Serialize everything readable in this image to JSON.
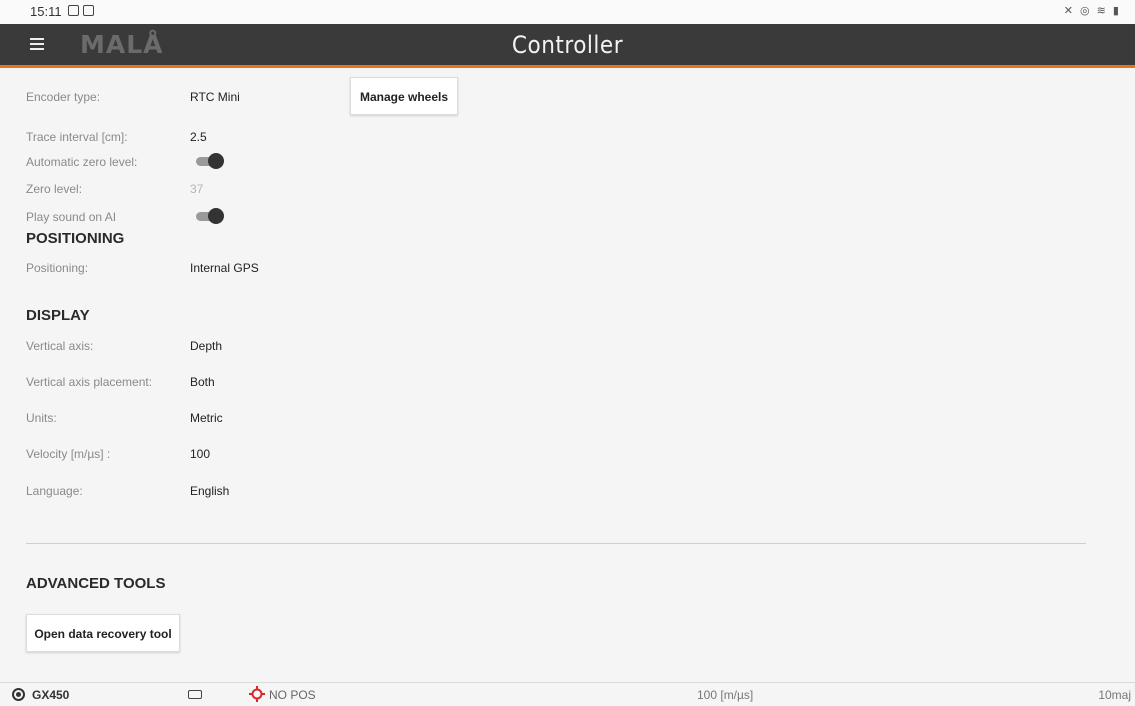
{
  "status_bar": {
    "time": "15:11"
  },
  "app_bar": {
    "logo": "MALÅ",
    "title": "Controller"
  },
  "settings": {
    "encoder_type": {
      "label": "Encoder type:",
      "value": "RTC Mini"
    },
    "manage_wheels_button": "Manage wheels",
    "trace_interval": {
      "label": "Trace interval [cm]:",
      "value": "2.5"
    },
    "automatic_zero_level": {
      "label": "Automatic zero level:",
      "enabled": true
    },
    "zero_level": {
      "label": "Zero level:",
      "value": "37"
    },
    "play_sound": {
      "label": "Play sound on AI",
      "enabled": true
    }
  },
  "positioning": {
    "heading": "POSITIONING",
    "positioning": {
      "label": "Positioning:",
      "value": "Internal GPS"
    }
  },
  "display": {
    "heading": "DISPLAY",
    "vertical_axis": {
      "label": "Vertical axis:",
      "value": "Depth"
    },
    "vertical_axis_placement": {
      "label": "Vertical axis placement:",
      "value": "Both"
    },
    "units": {
      "label": "Units:",
      "value": "Metric"
    },
    "velocity": {
      "label": "Velocity [m/µs] :",
      "value": "100"
    },
    "language": {
      "label": "Language:",
      "value": "English"
    }
  },
  "advanced_tools": {
    "heading": "ADVANCED TOOLS",
    "recovery_button": "Open data recovery tool"
  },
  "bottom_bar": {
    "device": "GX450",
    "position_status": "NO POS",
    "velocity": "100 [m/µs]",
    "scale": "10maj"
  },
  "colors": {
    "app_bar": "#3a3a3a",
    "accent": "#e8731e",
    "gps_icon": "#d9262b"
  }
}
